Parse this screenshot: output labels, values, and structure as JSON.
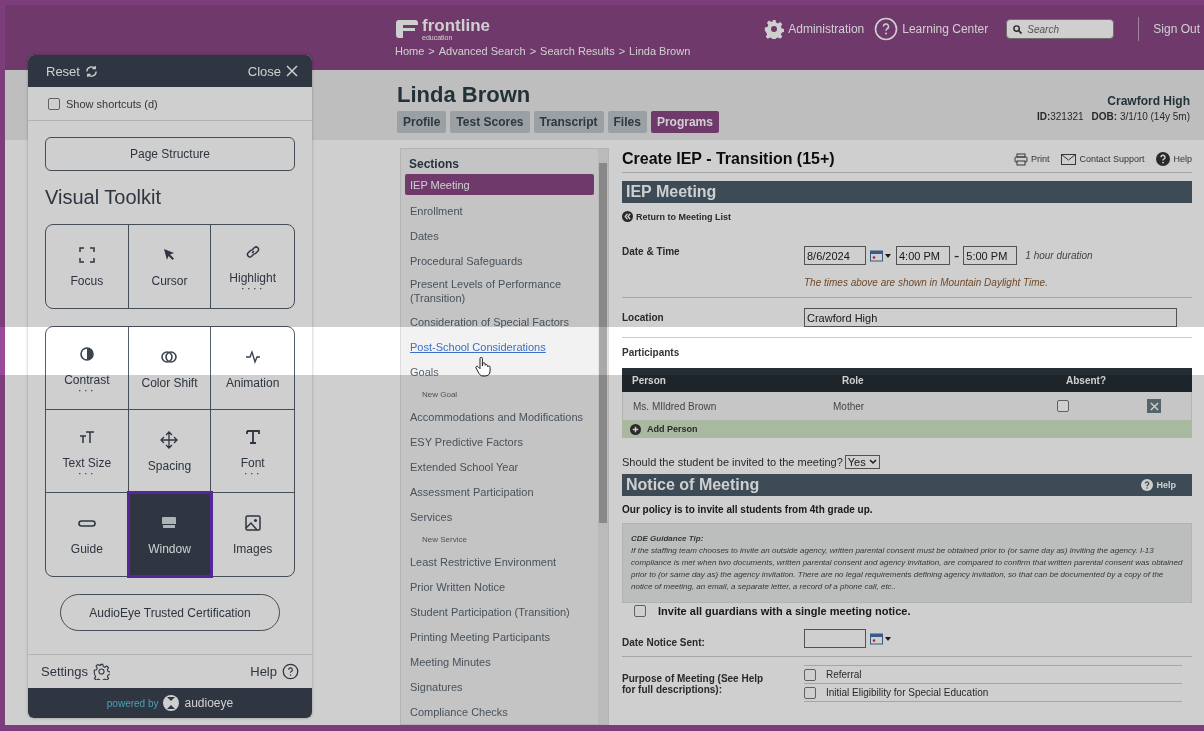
{
  "header": {
    "logo_text": "frontline",
    "logo_sub": "education",
    "nav": [
      {
        "kind": "gear",
        "label": "Administration"
      },
      {
        "kind": "question",
        "label": "Learning Center"
      }
    ],
    "search": {
      "placeholder": "Search"
    },
    "sign_out": "Sign Out",
    "breadcrumb": {
      "separator": ">",
      "items": [
        "Home",
        "Advanced Search",
        "Search Results",
        "Linda Brown"
      ]
    }
  },
  "student": {
    "name": "Linda Brown",
    "tabs": [
      {
        "label": "Profile",
        "selected": false
      },
      {
        "label": "Test Scores",
        "selected": false
      },
      {
        "label": "Transcript",
        "selected": false
      },
      {
        "label": "Files",
        "selected": false
      },
      {
        "label": "Programs",
        "selected": true
      }
    ],
    "school": "Crawford High",
    "id_label": "ID:",
    "id": "321321",
    "dob_label": "DOB:",
    "dob": "3/1/10 (14y 5m)"
  },
  "sections": {
    "title": "Sections",
    "items": [
      {
        "label": "IEP Meeting",
        "selected": true,
        "hovered": false
      },
      {
        "label": "Enrollment",
        "selected": false,
        "hovered": false
      },
      {
        "label": "Dates",
        "selected": false,
        "hovered": false
      },
      {
        "label": "Procedural Safeguards",
        "selected": false,
        "hovered": false
      },
      {
        "label": "Present Levels of Performance (Transition)",
        "selected": false,
        "hovered": false
      },
      {
        "label": "Consideration of Special Factors",
        "selected": false,
        "hovered": false
      },
      {
        "label": "Post-School Considerations",
        "selected": false,
        "hovered": true
      },
      {
        "label": "Goals",
        "selected": false,
        "hovered": false,
        "children": [
          {
            "label": "New Goal"
          }
        ]
      },
      {
        "label": "Accommodations and Modifications",
        "selected": false,
        "hovered": false
      },
      {
        "label": "ESY Predictive Factors",
        "selected": false,
        "hovered": false
      },
      {
        "label": "Extended School Year",
        "selected": false,
        "hovered": false
      },
      {
        "label": "Assessment Participation",
        "selected": false,
        "hovered": false
      },
      {
        "label": "Services",
        "selected": false,
        "hovered": false,
        "children": [
          {
            "label": "New Service"
          }
        ]
      },
      {
        "label": "Least Restrictive Environment",
        "selected": false,
        "hovered": false
      },
      {
        "label": "Prior Written Notice",
        "selected": false,
        "hovered": false
      },
      {
        "label": "Student Participation (Transition)",
        "selected": false,
        "hovered": false
      },
      {
        "label": "Printing Meeting Participants",
        "selected": false,
        "hovered": false
      },
      {
        "label": "Meeting Minutes",
        "selected": false,
        "hovered": false
      },
      {
        "label": "Signatures",
        "selected": false,
        "hovered": false
      },
      {
        "label": "Compliance Checks",
        "selected": false,
        "hovered": false
      }
    ]
  },
  "form": {
    "title": "Create IEP - Transition (15+)",
    "actions": [
      {
        "kind": "print",
        "label": "Print"
      },
      {
        "kind": "mail",
        "label": "Contact Support"
      },
      {
        "kind": "help",
        "label": "Help"
      }
    ],
    "meeting_header": "IEP Meeting",
    "return_link": "Return to Meeting List",
    "date_time": {
      "label": "Date & Time",
      "date": "8/6/2024",
      "start": "4:00 PM",
      "separator": "-",
      "end": "5:00 PM",
      "duration": "1 hour duration",
      "note": "The times above are shown in Mountain Daylight Time."
    },
    "location": {
      "label": "Location",
      "value": "Crawford High"
    },
    "participants": {
      "label": "Participants",
      "columns": [
        "Person",
        "Role",
        "Absent?"
      ],
      "rows": [
        {
          "person": "Ms. MIldred Brown",
          "role": "Mother",
          "absent": false
        }
      ],
      "add": "Add Person"
    },
    "invite_question": {
      "label": "Should the student be invited to the meeting?",
      "value": "Yes"
    },
    "notice_header": "Notice of Meeting",
    "notice_help": "Help",
    "policy": "Our policy is to invite all students from 4th grade up.",
    "tip": {
      "title": "CDE Guidance Tip:",
      "text": "If the staffing team chooses to invite an outside agency, written parental consent must be obtained prior to (or same day as) inviting the agency. I-13 compliance is met when two documents, written parental consent and agency invitation, are compared to confirm that written parental consent was obtained prior to (or same day as) the agency invitation. There are no legal requirements defining agency invitation, so that can be documented by a copy of the notice of meeting, an email, a separate letter, a record of a phone call, etc.."
    },
    "invite_all": {
      "label": "Invite all guardians with a single meeting notice.",
      "checked": false
    },
    "date_notice": {
      "label": "Date Notice Sent:"
    },
    "purpose": {
      "label": "Purpose of Meeting (See Help for full descriptions):",
      "options": [
        {
          "label": "Referral",
          "checked": false
        },
        {
          "label": "Initial Eligibility for Special Education",
          "checked": false
        }
      ]
    }
  },
  "toolkit": {
    "reset": "Reset",
    "close": "Close",
    "shortcuts": {
      "label": "Show shortcuts (d)",
      "checked": false
    },
    "page_structure": "Page Structure",
    "title": "Visual Toolkit",
    "groups": [
      [
        {
          "kind": "focus",
          "label": "Focus",
          "selected": false
        },
        {
          "kind": "cursor",
          "label": "Cursor",
          "selected": false
        },
        {
          "kind": "highlight",
          "label": "Highlight",
          "selected": false,
          "dots": "····"
        }
      ],
      [
        {
          "kind": "contrast",
          "label": "Contrast",
          "selected": false,
          "dots": "···"
        },
        {
          "kind": "colorshift",
          "label": "Color Shift",
          "selected": false
        },
        {
          "kind": "animation",
          "label": "Animation",
          "selected": false
        },
        {
          "kind": "textsize",
          "label": "Text Size",
          "selected": false,
          "dots": "···"
        },
        {
          "kind": "spacing",
          "label": "Spacing",
          "selected": false
        },
        {
          "kind": "font",
          "label": "Font",
          "selected": false,
          "dots": "···"
        },
        {
          "kind": "guide",
          "label": "Guide",
          "selected": false
        },
        {
          "kind": "window",
          "label": "Window",
          "selected": true
        },
        {
          "kind": "images",
          "label": "Images",
          "selected": false
        }
      ]
    ],
    "certification": "AudioEye Trusted Certification",
    "settings": "Settings",
    "help": "Help",
    "powered_by": "powered by",
    "brand": "audioeye"
  }
}
